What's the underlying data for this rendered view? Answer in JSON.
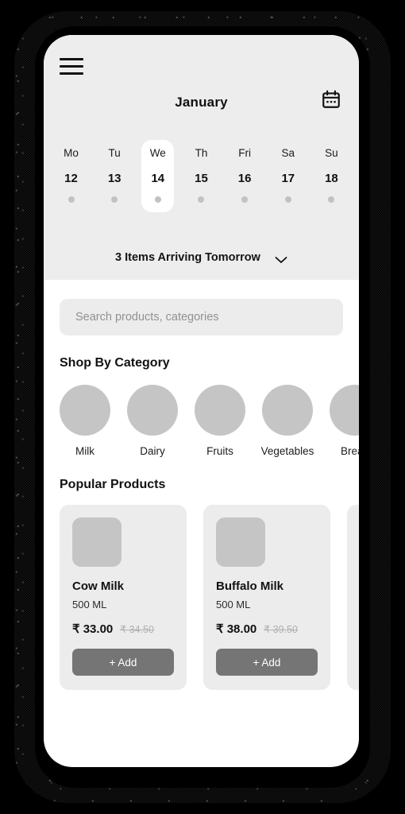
{
  "header": {
    "menu_icon": "hamburger-menu-icon",
    "month": "January",
    "calendar_icon": "calendar-icon",
    "days": [
      {
        "name": "Mo",
        "num": "12",
        "selected": false
      },
      {
        "name": "Tu",
        "num": "13",
        "selected": false
      },
      {
        "name": "We",
        "num": "14",
        "selected": true
      },
      {
        "name": "Th",
        "num": "15",
        "selected": false
      },
      {
        "name": "Fri",
        "num": "16",
        "selected": false
      },
      {
        "name": "Sa",
        "num": "17",
        "selected": false
      },
      {
        "name": "Su",
        "num": "18",
        "selected": false
      }
    ],
    "arriving_text": "3 Items Arriving Tomorrow",
    "arriving_chevron_icon": "chevron-down-icon"
  },
  "search": {
    "placeholder": "Search products, categories",
    "value": ""
  },
  "categories": {
    "title": "Shop By Category",
    "items": [
      {
        "label": "Milk"
      },
      {
        "label": "Dairy"
      },
      {
        "label": "Fruits"
      },
      {
        "label": "Vegetables"
      },
      {
        "label": "Bread"
      }
    ]
  },
  "products": {
    "title": "Popular Products",
    "add_label": "+ Add",
    "items": [
      {
        "name": "Cow Milk",
        "size": "500 ML",
        "price": "₹ 33.00",
        "old_price": "₹ 34.50"
      },
      {
        "name": "Buffalo Milk",
        "size": "500 ML",
        "price": "₹ 38.00",
        "old_price": "₹ 39.50"
      },
      {
        "name": "",
        "size": "",
        "price": "",
        "old_price": ""
      }
    ]
  },
  "colors": {
    "header_bg": "#ededed",
    "card_bg": "#ececec",
    "placeholder_grey": "#c5c5c5",
    "add_button": "#757575",
    "text_primary": "#111111"
  }
}
